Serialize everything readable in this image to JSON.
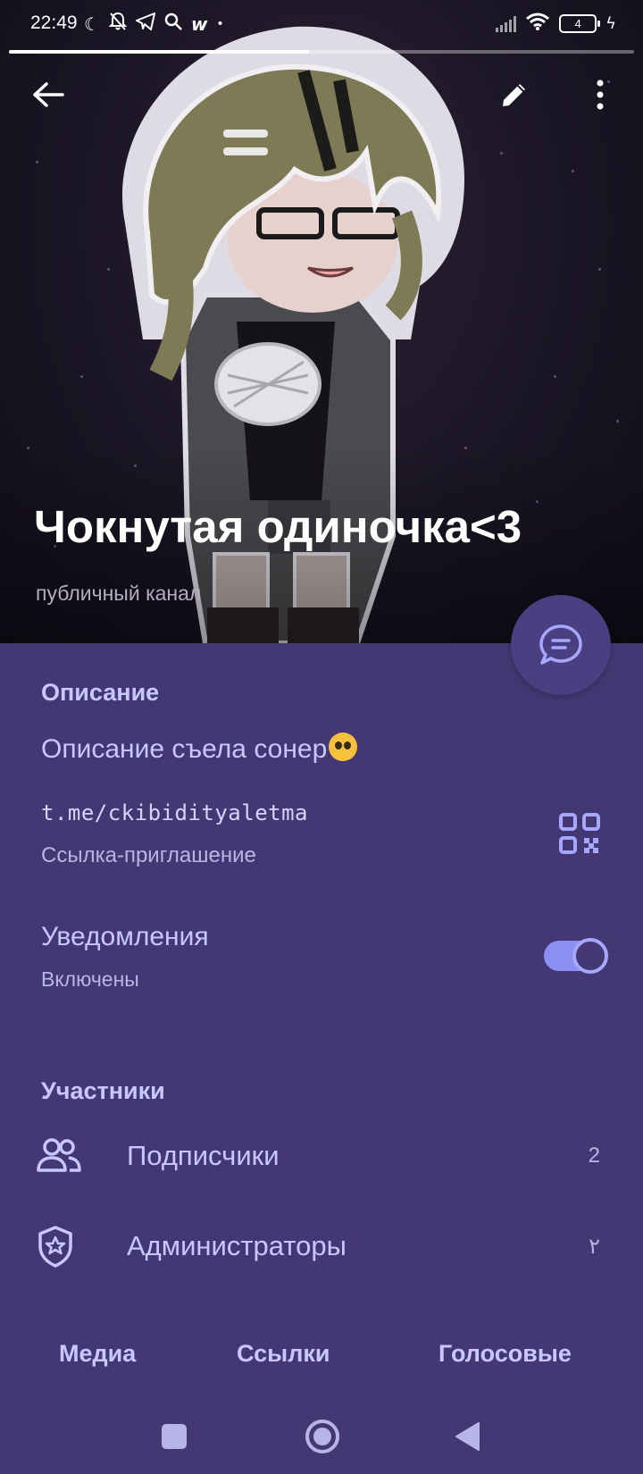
{
  "status_bar": {
    "time": "22:49",
    "battery": "4",
    "story_progress": 0.48
  },
  "channel": {
    "title": "Чокнутая одиночка<3",
    "subtitle": "публичный канал"
  },
  "description": {
    "heading": "Описание",
    "text": "Описание съела сонер",
    "emoji": "pleading-face"
  },
  "invite": {
    "link": "t.me/ckibidityaletma",
    "label": "Ссылка-приглашение"
  },
  "notifications": {
    "title": "Уведомления",
    "status": "Включены",
    "enabled": true
  },
  "members": {
    "heading": "Участники",
    "rows": [
      {
        "label": "Подписчики",
        "count": "2",
        "icon": "people-icon"
      },
      {
        "label": "Администраторы",
        "count": "٢",
        "icon": "shield-star-icon"
      }
    ]
  },
  "tabs": [
    "Медиа",
    "Ссылки",
    "Голосовые"
  ],
  "colors": {
    "panel_bg": "#433873",
    "accent_text": "#c9c7ff",
    "toggle_on": "#8c8ff2"
  }
}
